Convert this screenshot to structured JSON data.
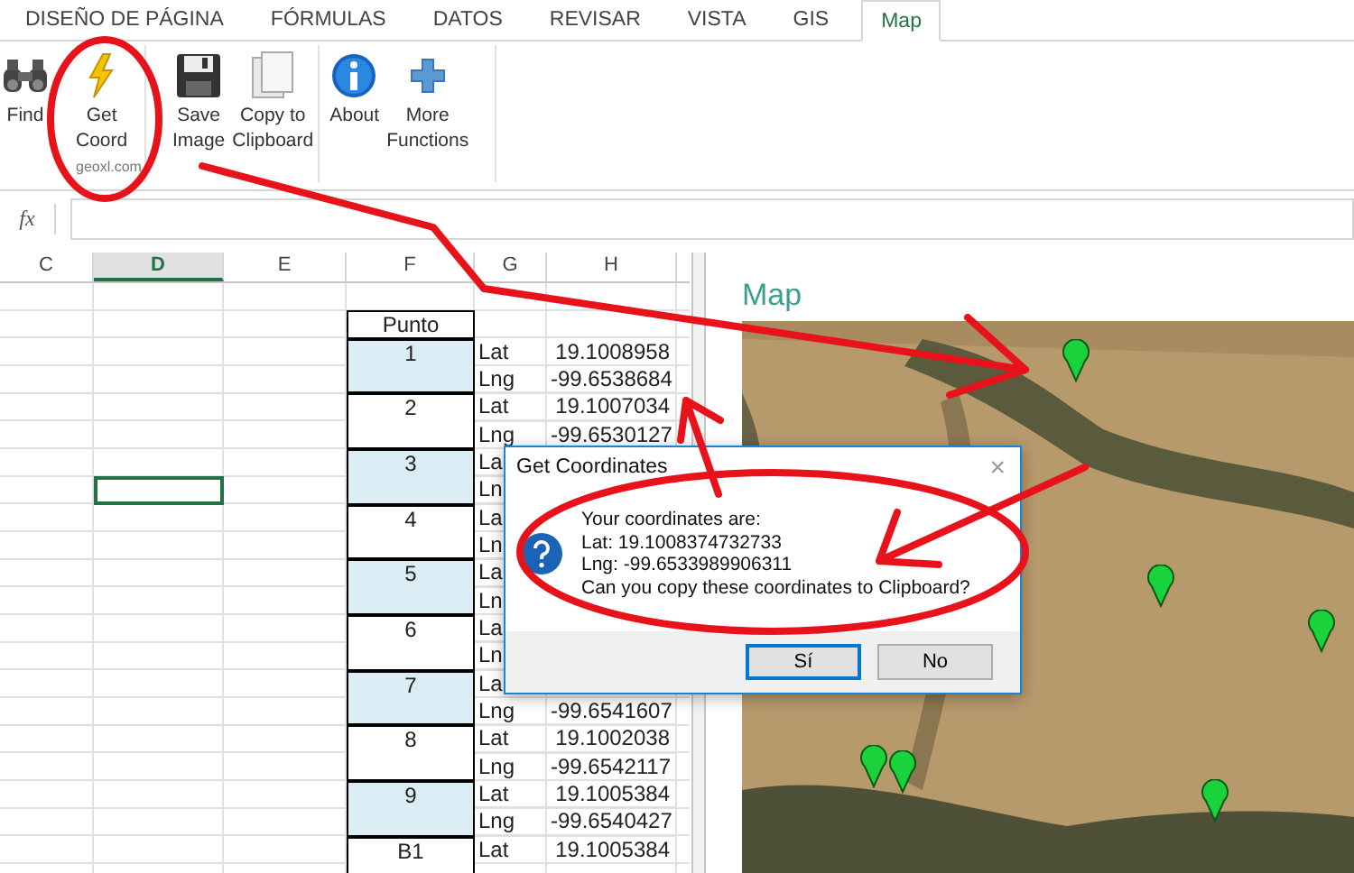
{
  "ribbon_tabs": [
    {
      "label": "DISEÑO DE PÁGINA",
      "selected": false
    },
    {
      "label": "FÓRMULAS",
      "selected": false
    },
    {
      "label": "DATOS",
      "selected": false
    },
    {
      "label": "REVISAR",
      "selected": false
    },
    {
      "label": "VISTA",
      "selected": false
    },
    {
      "label": "GIS",
      "selected": false
    },
    {
      "label": "Map",
      "selected": true
    }
  ],
  "ribbon": {
    "buttons": [
      {
        "kind": "binoculars",
        "label": "Find"
      },
      {
        "kind": "lightning",
        "label": "Get\nCoord"
      },
      {
        "kind": "floppy",
        "label": "Save\nImage"
      },
      {
        "kind": "pages",
        "label": "Copy to\nClipboard"
      },
      {
        "kind": "info",
        "label": "About"
      },
      {
        "kind": "plus",
        "label": "More\nFunctions"
      }
    ],
    "group_label": "geoxl.com"
  },
  "formula_bar": {
    "function_label": "fx"
  },
  "sheet": {
    "columns": [
      {
        "label": "C",
        "selected": false
      },
      {
        "label": "D",
        "selected": true
      },
      {
        "label": "E",
        "selected": false
      },
      {
        "label": "F",
        "selected": false
      },
      {
        "label": "G",
        "selected": false
      },
      {
        "label": "H",
        "selected": false
      }
    ],
    "header_cell": "Punto",
    "points": [
      {
        "label": "1",
        "highlighted": true,
        "rows": [
          {
            "axis": "Lat",
            "value": "19.1008958"
          },
          {
            "axis": "Lng",
            "value": "-99.6538684"
          }
        ]
      },
      {
        "label": "2",
        "highlighted": false,
        "rows": [
          {
            "axis": "Lat",
            "value": "19.1007034"
          },
          {
            "axis": "Lng",
            "value": "-99.6530127"
          }
        ]
      },
      {
        "label": "3",
        "highlighted": true,
        "rows": [
          {
            "axis": "La"
          },
          {
            "axis": "Ln"
          }
        ]
      },
      {
        "label": "4",
        "highlighted": false,
        "rows": [
          {
            "axis": "La"
          },
          {
            "axis": "Ln"
          }
        ]
      },
      {
        "label": "5",
        "highlighted": true,
        "rows": [
          {
            "axis": "La"
          },
          {
            "axis": "Ln"
          }
        ]
      },
      {
        "label": "6",
        "highlighted": false,
        "rows": [
          {
            "axis": "La"
          },
          {
            "axis": "Ln"
          }
        ]
      },
      {
        "label": "7",
        "highlighted": true,
        "rows": [
          {
            "axis": "La"
          },
          {
            "axis": "Lng",
            "value": "-99.6541607"
          }
        ]
      },
      {
        "label": "8",
        "highlighted": false,
        "rows": [
          {
            "axis": "Lat",
            "value": "19.1002038"
          },
          {
            "axis": "Lng",
            "value": "-99.6542117"
          }
        ]
      },
      {
        "label": "9",
        "highlighted": true,
        "rows": [
          {
            "axis": "Lat",
            "value": "19.1005384"
          },
          {
            "axis": "Lng",
            "value": "-99.6540427"
          }
        ]
      },
      {
        "label": "B1",
        "highlighted": false,
        "rows": [
          {
            "axis": "Lat",
            "value": "19.1005384"
          }
        ]
      }
    ]
  },
  "map_pane": {
    "title": "Map"
  },
  "dialog": {
    "title": "Get Coordinates",
    "close": "×",
    "message_lines": [
      "Your coordinates are:",
      "Lat: 19.1008374732733",
      "Lng: -99.6533989906311",
      "Can you copy these coordinates to Clipboard?"
    ],
    "buttons": [
      {
        "label": "Sí",
        "default": true
      },
      {
        "label": "No",
        "default": false
      }
    ]
  }
}
